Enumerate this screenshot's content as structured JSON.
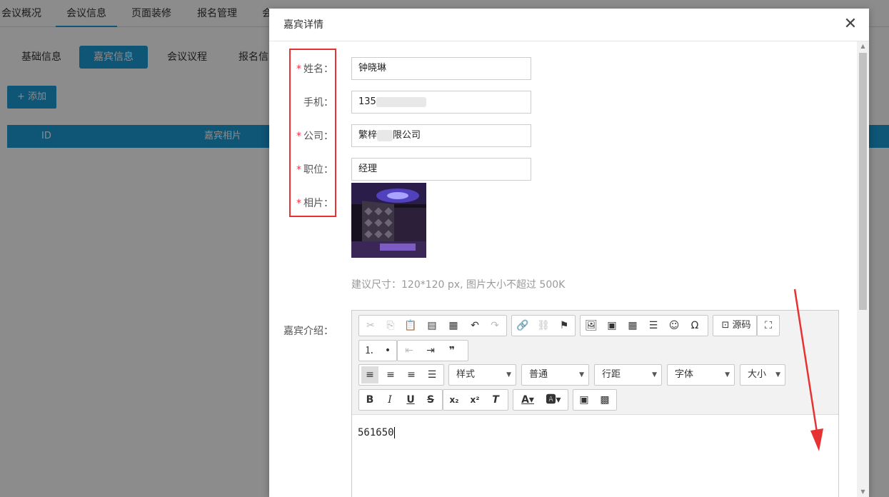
{
  "top_tabs": [
    "会议概况",
    "会议信息",
    "页面装修",
    "报名管理",
    "会"
  ],
  "sub_tabs": [
    "基础信息",
    "嘉宾信息",
    "会议议程",
    "报名信"
  ],
  "add_button": "+ 添加",
  "table_headers": [
    "ID",
    "嘉宾相片"
  ],
  "modal": {
    "title": "嘉宾详情",
    "close_symbol": "✕",
    "fields": [
      {
        "label": "姓名：",
        "required": true,
        "value": "钟晓琳"
      },
      {
        "label": "手机：",
        "required": false,
        "value": "135"
      },
      {
        "label": "公司：",
        "required": true,
        "value_prefix": "繁梓",
        "value_suffix": "限公司"
      },
      {
        "label": "职位：",
        "required": true,
        "value": "经理"
      },
      {
        "label": "相片：",
        "required": true
      }
    ],
    "required_mark": "*",
    "photo_hint": "建议尺寸：120*120 px, 图片大小不超过 500K",
    "intro_label": "嘉宾介绍：",
    "editor": {
      "source_label": "源码",
      "selects": [
        "样式",
        "普通",
        "行距",
        "字体",
        "大小"
      ],
      "content": "561650"
    }
  },
  "colors": {
    "accent": "#1a9bd7",
    "highlight": "#e63232"
  }
}
